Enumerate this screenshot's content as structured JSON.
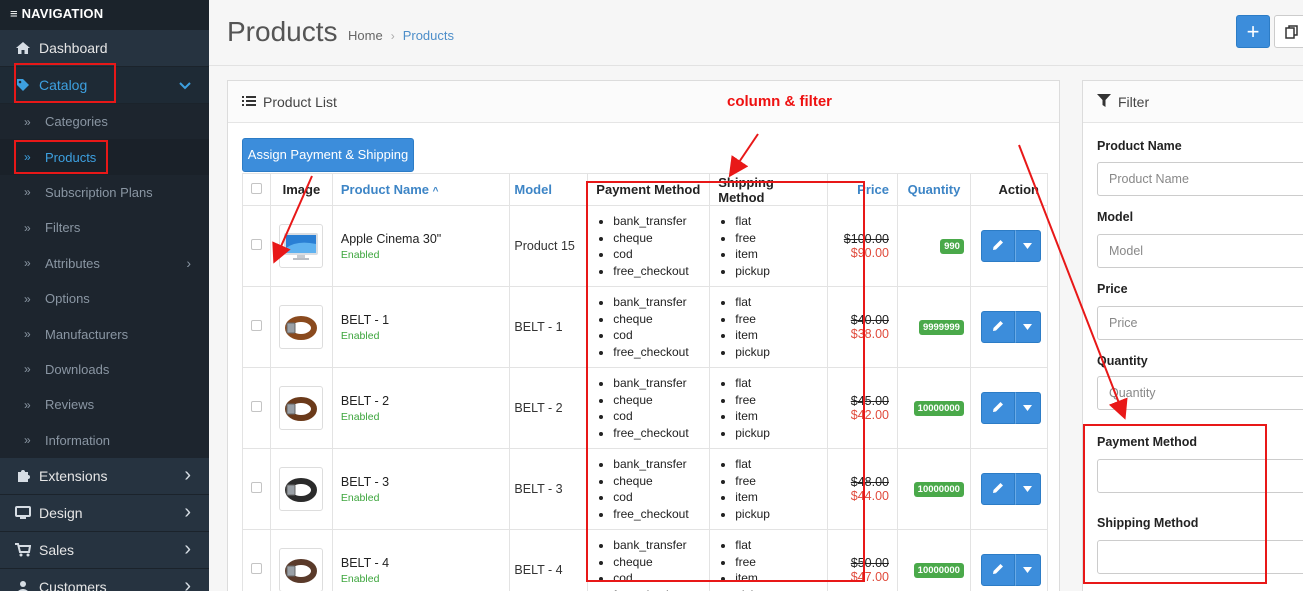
{
  "sidebar": {
    "header": "≡ NAVIGATION",
    "menu_top": [
      {
        "label": "Dashboard",
        "icon": "home-icon"
      },
      {
        "label": "Catalog",
        "icon": "tag-icon"
      }
    ],
    "catalog_items": [
      {
        "label": "Categories"
      },
      {
        "label": "Products"
      },
      {
        "label": "Subscription Plans"
      },
      {
        "label": "Filters"
      },
      {
        "label": "Attributes"
      },
      {
        "label": "Options"
      },
      {
        "label": "Manufacturers"
      },
      {
        "label": "Downloads"
      },
      {
        "label": "Reviews"
      },
      {
        "label": "Information"
      }
    ],
    "menu_bottom": [
      {
        "label": "Extensions",
        "icon": "puzzle-icon"
      },
      {
        "label": "Design",
        "icon": "monitor-icon"
      },
      {
        "label": "Sales",
        "icon": "cart-icon"
      },
      {
        "label": "Customers",
        "icon": "user-icon"
      }
    ]
  },
  "header": {
    "title": "Products",
    "breadcrumb": {
      "home": "Home",
      "current": "Products"
    },
    "add_label": "+"
  },
  "product_panel": {
    "title": "Product List",
    "assign_button": "Assign Payment & Shipping",
    "columns": {
      "image": "Image",
      "name": "Product Name",
      "model": "Model",
      "payment": "Payment Method",
      "shipping": "Shipping Method",
      "price": "Price",
      "quantity": "Quantity",
      "action": "Action"
    },
    "rows": [
      {
        "name": "Apple Cinema 30\"",
        "status": "Enabled",
        "model": "Product 15",
        "payment": [
          "bank_transfer",
          "cheque",
          "cod",
          "free_checkout"
        ],
        "shipping": [
          "flat",
          "free",
          "item",
          "pickup"
        ],
        "price_old": "$100.00",
        "price_new": "$90.00",
        "quantity": "990"
      },
      {
        "name": "BELT - 1",
        "status": "Enabled",
        "model": "BELT - 1",
        "payment": [
          "bank_transfer",
          "cheque",
          "cod",
          "free_checkout"
        ],
        "shipping": [
          "flat",
          "free",
          "item",
          "pickup"
        ],
        "price_old": "$40.00",
        "price_new": "$38.00",
        "quantity": "9999999"
      },
      {
        "name": "BELT - 2",
        "status": "Enabled",
        "model": "BELT - 2",
        "payment": [
          "bank_transfer",
          "cheque",
          "cod",
          "free_checkout"
        ],
        "shipping": [
          "flat",
          "free",
          "item",
          "pickup"
        ],
        "price_old": "$45.00",
        "price_new": "$42.00",
        "quantity": "10000000"
      },
      {
        "name": "BELT - 3",
        "status": "Enabled",
        "model": "BELT - 3",
        "payment": [
          "bank_transfer",
          "cheque",
          "cod",
          "free_checkout"
        ],
        "shipping": [
          "flat",
          "free",
          "item",
          "pickup"
        ],
        "price_old": "$48.00",
        "price_new": "$44.00",
        "quantity": "10000000"
      },
      {
        "name": "BELT - 4",
        "status": "Enabled",
        "model": "BELT - 4",
        "payment": [
          "bank_transfer",
          "cheque",
          "cod",
          "free_checkout"
        ],
        "shipping": [
          "flat",
          "free",
          "item",
          "pickup"
        ],
        "price_old": "$50.00",
        "price_new": "$47.00",
        "quantity": "10000000"
      }
    ]
  },
  "filter_panel": {
    "title": "Filter",
    "fields": [
      {
        "label": "Product Name",
        "placeholder": "Product Name"
      },
      {
        "label": "Model",
        "placeholder": "Model"
      },
      {
        "label": "Price",
        "placeholder": "Price"
      },
      {
        "label": "Quantity",
        "placeholder": "Quantity"
      },
      {
        "label": "Payment Method",
        "placeholder": ""
      },
      {
        "label": "Shipping Method",
        "placeholder": ""
      }
    ]
  },
  "annotation": {
    "text": "column & filter",
    "color": "#ee1111"
  },
  "colors": {
    "sidebar_bg": "#222c36",
    "accent": "#3c8ddb",
    "enabled": "#3ca53c",
    "sale_price": "#e04b3c",
    "badge": "#4aa94a"
  }
}
